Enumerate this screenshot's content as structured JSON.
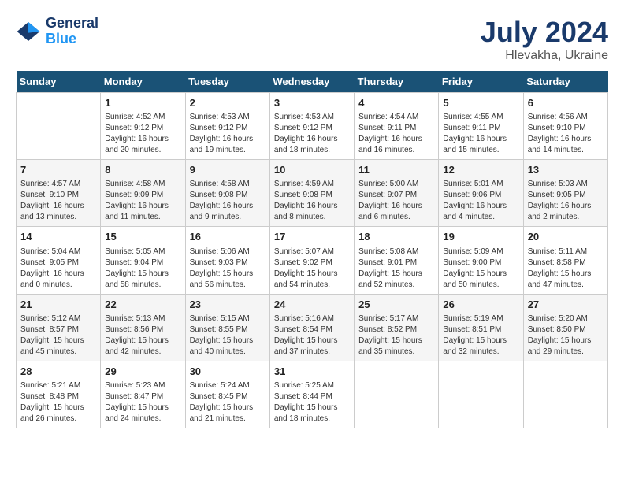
{
  "header": {
    "logo_line1": "General",
    "logo_line2": "Blue",
    "month": "July 2024",
    "location": "Hlevakha, Ukraine"
  },
  "days_of_week": [
    "Sunday",
    "Monday",
    "Tuesday",
    "Wednesday",
    "Thursday",
    "Friday",
    "Saturday"
  ],
  "weeks": [
    [
      {
        "day": "",
        "info": ""
      },
      {
        "day": "1",
        "info": "Sunrise: 4:52 AM\nSunset: 9:12 PM\nDaylight: 16 hours\nand 20 minutes."
      },
      {
        "day": "2",
        "info": "Sunrise: 4:53 AM\nSunset: 9:12 PM\nDaylight: 16 hours\nand 19 minutes."
      },
      {
        "day": "3",
        "info": "Sunrise: 4:53 AM\nSunset: 9:12 PM\nDaylight: 16 hours\nand 18 minutes."
      },
      {
        "day": "4",
        "info": "Sunrise: 4:54 AM\nSunset: 9:11 PM\nDaylight: 16 hours\nand 16 minutes."
      },
      {
        "day": "5",
        "info": "Sunrise: 4:55 AM\nSunset: 9:11 PM\nDaylight: 16 hours\nand 15 minutes."
      },
      {
        "day": "6",
        "info": "Sunrise: 4:56 AM\nSunset: 9:10 PM\nDaylight: 16 hours\nand 14 minutes."
      }
    ],
    [
      {
        "day": "7",
        "info": "Sunrise: 4:57 AM\nSunset: 9:10 PM\nDaylight: 16 hours\nand 13 minutes."
      },
      {
        "day": "8",
        "info": "Sunrise: 4:58 AM\nSunset: 9:09 PM\nDaylight: 16 hours\nand 11 minutes."
      },
      {
        "day": "9",
        "info": "Sunrise: 4:58 AM\nSunset: 9:08 PM\nDaylight: 16 hours\nand 9 minutes."
      },
      {
        "day": "10",
        "info": "Sunrise: 4:59 AM\nSunset: 9:08 PM\nDaylight: 16 hours\nand 8 minutes."
      },
      {
        "day": "11",
        "info": "Sunrise: 5:00 AM\nSunset: 9:07 PM\nDaylight: 16 hours\nand 6 minutes."
      },
      {
        "day": "12",
        "info": "Sunrise: 5:01 AM\nSunset: 9:06 PM\nDaylight: 16 hours\nand 4 minutes."
      },
      {
        "day": "13",
        "info": "Sunrise: 5:03 AM\nSunset: 9:05 PM\nDaylight: 16 hours\nand 2 minutes."
      }
    ],
    [
      {
        "day": "14",
        "info": "Sunrise: 5:04 AM\nSunset: 9:05 PM\nDaylight: 16 hours\nand 0 minutes."
      },
      {
        "day": "15",
        "info": "Sunrise: 5:05 AM\nSunset: 9:04 PM\nDaylight: 15 hours\nand 58 minutes."
      },
      {
        "day": "16",
        "info": "Sunrise: 5:06 AM\nSunset: 9:03 PM\nDaylight: 15 hours\nand 56 minutes."
      },
      {
        "day": "17",
        "info": "Sunrise: 5:07 AM\nSunset: 9:02 PM\nDaylight: 15 hours\nand 54 minutes."
      },
      {
        "day": "18",
        "info": "Sunrise: 5:08 AM\nSunset: 9:01 PM\nDaylight: 15 hours\nand 52 minutes."
      },
      {
        "day": "19",
        "info": "Sunrise: 5:09 AM\nSunset: 9:00 PM\nDaylight: 15 hours\nand 50 minutes."
      },
      {
        "day": "20",
        "info": "Sunrise: 5:11 AM\nSunset: 8:58 PM\nDaylight: 15 hours\nand 47 minutes."
      }
    ],
    [
      {
        "day": "21",
        "info": "Sunrise: 5:12 AM\nSunset: 8:57 PM\nDaylight: 15 hours\nand 45 minutes."
      },
      {
        "day": "22",
        "info": "Sunrise: 5:13 AM\nSunset: 8:56 PM\nDaylight: 15 hours\nand 42 minutes."
      },
      {
        "day": "23",
        "info": "Sunrise: 5:15 AM\nSunset: 8:55 PM\nDaylight: 15 hours\nand 40 minutes."
      },
      {
        "day": "24",
        "info": "Sunrise: 5:16 AM\nSunset: 8:54 PM\nDaylight: 15 hours\nand 37 minutes."
      },
      {
        "day": "25",
        "info": "Sunrise: 5:17 AM\nSunset: 8:52 PM\nDaylight: 15 hours\nand 35 minutes."
      },
      {
        "day": "26",
        "info": "Sunrise: 5:19 AM\nSunset: 8:51 PM\nDaylight: 15 hours\nand 32 minutes."
      },
      {
        "day": "27",
        "info": "Sunrise: 5:20 AM\nSunset: 8:50 PM\nDaylight: 15 hours\nand 29 minutes."
      }
    ],
    [
      {
        "day": "28",
        "info": "Sunrise: 5:21 AM\nSunset: 8:48 PM\nDaylight: 15 hours\nand 26 minutes."
      },
      {
        "day": "29",
        "info": "Sunrise: 5:23 AM\nSunset: 8:47 PM\nDaylight: 15 hours\nand 24 minutes."
      },
      {
        "day": "30",
        "info": "Sunrise: 5:24 AM\nSunset: 8:45 PM\nDaylight: 15 hours\nand 21 minutes."
      },
      {
        "day": "31",
        "info": "Sunrise: 5:25 AM\nSunset: 8:44 PM\nDaylight: 15 hours\nand 18 minutes."
      },
      {
        "day": "",
        "info": ""
      },
      {
        "day": "",
        "info": ""
      },
      {
        "day": "",
        "info": ""
      }
    ]
  ]
}
